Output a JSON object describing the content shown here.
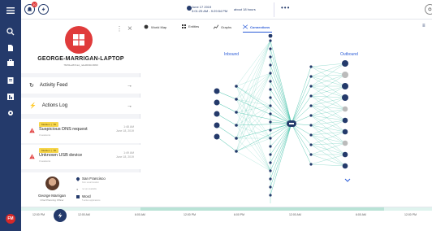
{
  "rail": {
    "badge": "10",
    "user_initials": "FM",
    "icons": [
      "hamburger-menu-icon",
      "alerts-icon",
      "bolt-icon",
      "search-icon",
      "file-icon",
      "briefcase-icon",
      "report-icon",
      "dashboard-icon",
      "settings-icon"
    ]
  },
  "topbar": {
    "date_line1": "June 17 2019",
    "date_line2": "3:01:25 AM - 9:29:54 PM",
    "duration": "about 18 hours",
    "more": "•••"
  },
  "device": {
    "hostname": "GEORGE-MARRIGAN-LAPTOP",
    "subid": "78c51ed67ca1_nde3001b1f060",
    "more": "⋮",
    "close": "×"
  },
  "menu": {
    "activity_feed": "Activity Feed",
    "actions_log": "Actions Log"
  },
  "alerts": [
    {
      "severity": "Medium",
      "score": "50",
      "title": "Suspicious DNS request",
      "sub": "3 sessions",
      "time1": "1:48 AM",
      "time2": "June 18, 2019"
    },
    {
      "severity": "Medium",
      "score": "50",
      "title": "Unknown USB device",
      "sub": "3 sessions",
      "time1": "1:49 AM",
      "time2": "June 18, 2019"
    }
  ],
  "user": {
    "name": "George Marrigan",
    "role": "Chief Planning Officer",
    "location": "San Francisco",
    "location_sub": "from usual location",
    "vpn_sub": "no vpn available",
    "app": "Word",
    "app_sub": "5 active applications"
  },
  "tabs": [
    {
      "label": "World Map",
      "icon": "globe-icon"
    },
    {
      "label": "Entities",
      "icon": "grid-icon"
    },
    {
      "label": "Graphs",
      "icon": "chart-icon"
    },
    {
      "label": "Connections",
      "icon": "connections-icon"
    }
  ],
  "graph": {
    "inbound_label": "Inbound",
    "outbound_label": "Outbound",
    "accent": "#2a5bd7",
    "edge_color": "#3fbfa6",
    "node_color": "#243a6b"
  },
  "timeline": {
    "labels": [
      "12:00 PM",
      "12:00 AM",
      "6:00 AM",
      "12:00 PM",
      "6:00 PM",
      "12:00 AM",
      "6:00 AM",
      "12:00 PM"
    ]
  },
  "colors": {
    "brand_navy": "#243a6b",
    "alert_red": "#e03b3b",
    "severity_yellow": "#f6d54b",
    "teal": "#3fbfa6"
  }
}
